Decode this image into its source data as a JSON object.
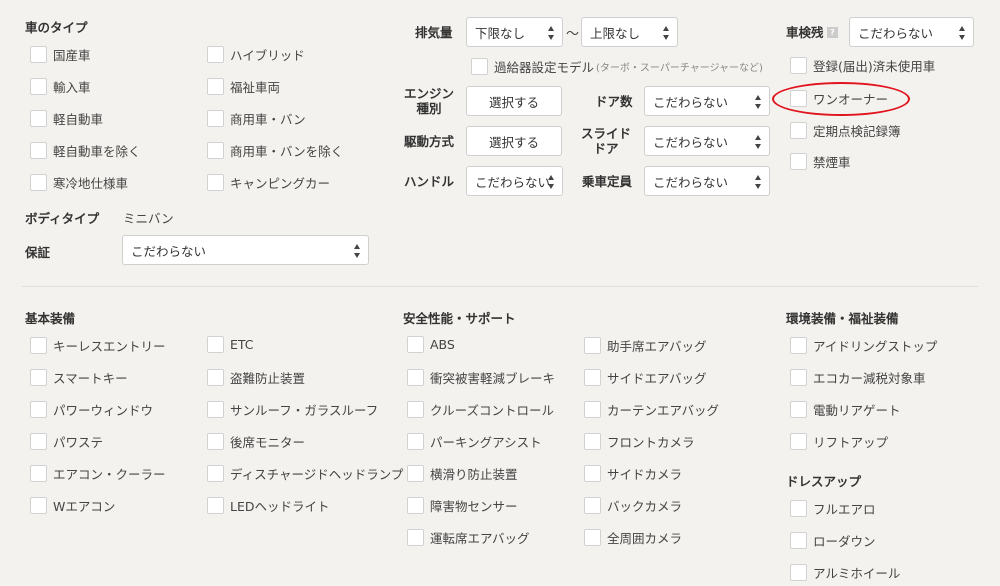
{
  "car_type": {
    "heading": "車のタイプ",
    "left": [
      "国産車",
      "輸入車",
      "軽自動車",
      "軽自動車を除く",
      "寒冷地仕様車"
    ],
    "right": [
      "ハイブリッド",
      "福祉車両",
      "商用車・バン",
      "商用車・バンを除く",
      "キャンピングカー"
    ]
  },
  "body_type": {
    "label": "ボディタイプ",
    "value": "ミニバン"
  },
  "warranty": {
    "label": "保証",
    "value": "こだわらない"
  },
  "displacement": {
    "label": "排気量",
    "min": "下限なし",
    "tilde": "〜",
    "max": "上限なし"
  },
  "turbo": {
    "label": "過給器設定モデル",
    "note": "(ターボ・スーパーチャージャーなど)"
  },
  "engine": {
    "label_line1": "エンジン",
    "label_line2": "種別",
    "button": "選択する"
  },
  "doors": {
    "label": "ドア数",
    "value": "こだわらない"
  },
  "drive": {
    "label": "駆動方式",
    "button": "選択する"
  },
  "slide_door": {
    "label_line1": "スライド",
    "label_line2": "ドア",
    "value": "こだわらない"
  },
  "handle": {
    "label": "ハンドル",
    "value": "こだわらない"
  },
  "capacity": {
    "label": "乗車定員",
    "value": "こだわらない"
  },
  "inspection": {
    "label": "車検残",
    "help": "?",
    "value": "こだわらない"
  },
  "conditions": [
    "登録(届出)済未使用車",
    "ワンオーナー",
    "定期点検記録簿",
    "禁煙車"
  ],
  "basic": {
    "heading": "基本装備",
    "left": [
      "キーレスエントリー",
      "スマートキー",
      "パワーウィンドウ",
      "パワステ",
      "エアコン・クーラー",
      "Wエアコン"
    ],
    "right": [
      "ETC",
      "盗難防止装置",
      "サンルーフ・ガラスルーフ",
      "後席モニター",
      "ディスチャージドヘッドランプ",
      "LEDヘッドライト"
    ]
  },
  "safety": {
    "heading": "安全性能・サポート",
    "left": [
      "ABS",
      "衝突被害軽減ブレーキ",
      "クルーズコントロール",
      "パーキングアシスト",
      "横滑り防止装置",
      "障害物センサー",
      "運転席エアバッグ"
    ],
    "right": [
      "助手席エアバッグ",
      "サイドエアバッグ",
      "カーテンエアバッグ",
      "フロントカメラ",
      "サイドカメラ",
      "バックカメラ",
      "全周囲カメラ"
    ]
  },
  "env": {
    "heading": "環境装備・福祉装備",
    "items": [
      "アイドリングストップ",
      "エコカー減税対象車",
      "電動リアゲート",
      "リフトアップ"
    ]
  },
  "dressup": {
    "heading": "ドレスアップ",
    "items": [
      "フルエアロ",
      "ローダウン",
      "アルミホイール"
    ]
  },
  "annotation_color": "#e0141e"
}
